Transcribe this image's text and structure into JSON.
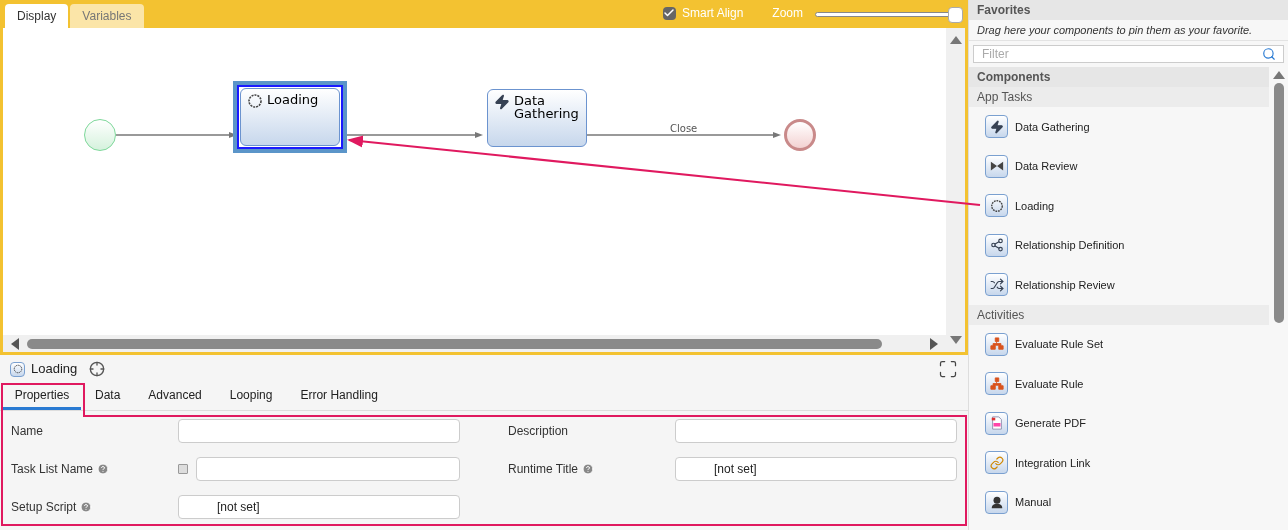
{
  "canvas_tabs": [
    {
      "label": "Display",
      "selected": true
    },
    {
      "label": "Variables",
      "selected": false
    }
  ],
  "smart_align": {
    "label": "Smart Align",
    "checked": true
  },
  "zoom": {
    "label": "Zoom",
    "level": 1
  },
  "diagram": {
    "nodes": [
      {
        "kind": "start"
      },
      {
        "kind": "loading",
        "label": "Loading",
        "selected": true
      },
      {
        "kind": "bolt",
        "label": "Data Gathering",
        "selected": false,
        "edge_label": "Close"
      },
      {
        "kind": "end"
      }
    ]
  },
  "properties": {
    "title": "Loading",
    "tabs": [
      {
        "label": "Properties",
        "selected": true
      },
      {
        "label": "Data",
        "selected": false
      },
      {
        "label": "Advanced",
        "selected": false
      },
      {
        "label": "Looping",
        "selected": false
      },
      {
        "label": "Error Handling",
        "selected": false
      }
    ],
    "fields": [
      {
        "kind": "text",
        "label": "Name",
        "help": false
      },
      {
        "kind": "text",
        "label": "Description",
        "help": false
      },
      {
        "kind": "localized",
        "label": "Task List Name",
        "help": true
      },
      {
        "kind": "text",
        "label": "Runtime Title",
        "help": true,
        "value": "[not set]"
      },
      {
        "kind": "text",
        "label": "Setup Script",
        "help": true,
        "value": "[not set]"
      }
    ]
  },
  "palette": {
    "favorites_title": "Favorites",
    "favorites_hint": "Drag here your components to pin them as your favorite.",
    "filter_placeholder": "Filter",
    "components_title": "Components",
    "groups": [
      {
        "title": "App Tasks",
        "items": [
          {
            "label": "Data Gathering",
            "kind": "bolt"
          },
          {
            "label": "Data Review",
            "kind": "review"
          },
          {
            "label": "Loading",
            "kind": "loading"
          },
          {
            "label": "Relationship Definition",
            "kind": "share"
          },
          {
            "label": "Relationship Review",
            "kind": "shuffle"
          }
        ]
      },
      {
        "title": "Activities",
        "items": [
          {
            "label": "Evaluate Rule Set",
            "kind": "rules"
          },
          {
            "label": "Evaluate Rule",
            "kind": "rule"
          },
          {
            "label": "Generate PDF",
            "kind": "pdf"
          },
          {
            "label": "Integration Link",
            "kind": "link"
          },
          {
            "label": "Manual",
            "kind": "person"
          }
        ]
      }
    ]
  }
}
